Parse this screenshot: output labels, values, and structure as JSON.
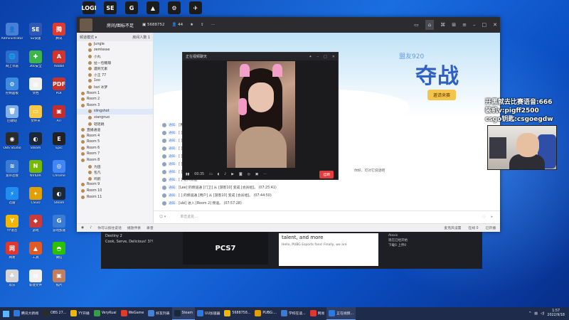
{
  "desktop_icons": [
    {
      "label": "Administrator",
      "color": "#4a7fd6",
      "glyph": "👤",
      "col": 0,
      "row": 0
    },
    {
      "label": "网上邻居",
      "color": "#2f6bc9",
      "glyph": "🌐",
      "col": 0,
      "row": 1
    },
    {
      "label": "控制面板",
      "color": "#3d8be0",
      "glyph": "⚙",
      "col": 0,
      "row": 2
    },
    {
      "label": "回收站",
      "color": "#7fb0e8",
      "glyph": "🗑",
      "col": 0,
      "row": 3
    },
    {
      "label": "OBS Studio",
      "color": "#2b2b2b",
      "glyph": "◉",
      "col": 0,
      "row": 4
    },
    {
      "label": "宽带连接",
      "color": "#3a7bd5",
      "glyph": "≋",
      "col": 0,
      "row": 5
    },
    {
      "label": "迅雷",
      "color": "#1f8df0",
      "glyph": "⚡",
      "col": 0,
      "row": 6
    },
    {
      "label": "YY语音",
      "color": "#f2b705",
      "glyph": "Y",
      "col": 0,
      "row": 7
    },
    {
      "label": "网易",
      "color": "#e0372e",
      "glyph": "网",
      "col": 0,
      "row": 8
    },
    {
      "label": "欢乐",
      "color": "#d6d6d6",
      "glyph": "♣",
      "col": 0,
      "row": 9
    },
    {
      "label": "SE快速",
      "color": "#2d58b8",
      "glyph": "SE",
      "col": 1,
      "row": 0
    },
    {
      "label": "360安全",
      "color": "#3eb549",
      "glyph": "✚",
      "col": 1,
      "row": 1
    },
    {
      "label": "文档",
      "color": "#f0f0f0",
      "glyph": "▤",
      "col": 1,
      "row": 2
    },
    {
      "label": "文件夹",
      "color": "#f5c945",
      "glyph": "▭",
      "col": 1,
      "row": 3
    },
    {
      "label": "Steam",
      "color": "#1b2838",
      "glyph": "◐",
      "col": 1,
      "row": 4
    },
    {
      "label": "NVIDIA",
      "color": "#76b900",
      "glyph": "N",
      "col": 1,
      "row": 5
    },
    {
      "label": "CSGO",
      "color": "#e0a000",
      "glyph": "✦",
      "col": 1,
      "row": 6
    },
    {
      "label": "游戏",
      "color": "#c93a3a",
      "glyph": "◆",
      "col": 1,
      "row": 7
    },
    {
      "label": "工具",
      "color": "#e05a23",
      "glyph": "▲",
      "col": 1,
      "row": 8
    },
    {
      "label": "新建文件",
      "color": "#f0f0f0",
      "glyph": "▤",
      "col": 1,
      "row": 9
    },
    {
      "label": "腾讯",
      "color": "#e03b2f",
      "glyph": "腾",
      "col": 2,
      "row": 0
    },
    {
      "label": "Adobe",
      "color": "#d4342c",
      "glyph": "A",
      "col": 2,
      "row": 1
    },
    {
      "label": "PDF",
      "color": "#c8322a",
      "glyph": "PDF",
      "col": 2,
      "row": 2
    },
    {
      "label": "ATI",
      "color": "#c32d2d",
      "glyph": "▣",
      "col": 2,
      "row": 3
    },
    {
      "label": "Epic",
      "color": "#222222",
      "glyph": "E",
      "col": 2,
      "row": 4
    },
    {
      "label": "Chrome",
      "color": "#4285f4",
      "glyph": "◎",
      "col": 2,
      "row": 5
    },
    {
      "label": "Steam",
      "color": "#1b2838",
      "glyph": "◐",
      "col": 2,
      "row": 6
    },
    {
      "label": "游戏加速",
      "color": "#3a7bd5",
      "glyph": "G",
      "col": 2,
      "row": 7
    },
    {
      "label": "微信",
      "color": "#2dc100",
      "glyph": "◓",
      "col": 2,
      "row": 8
    },
    {
      "label": "照片",
      "color": "#c08060",
      "glyph": "▣",
      "col": 2,
      "row": 9
    }
  ],
  "top_icons": [
    "LOGI",
    "SE",
    "G",
    "▲",
    "⚙",
    "✈"
  ],
  "app": {
    "title": "房间/图标不足",
    "viewers": "5688752",
    "fans": "44",
    "left_header_left": "频道模式 ▾",
    "left_header_right": "房间人数 1",
    "channel_items": [
      {
        "label": "Jungle",
        "cls": "sub"
      },
      {
        "label": "zemlesse",
        "cls": "sub"
      },
      {
        "label": "小丸",
        "cls": "sub"
      },
      {
        "label": "扯一包糖葫",
        "cls": "sub"
      },
      {
        "label": "遇到元素",
        "cls": "sub"
      },
      {
        "label": "小王 77",
        "cls": "sub"
      },
      {
        "label": "1oo",
        "cls": "sub"
      },
      {
        "label": "lozi 冰梦",
        "cls": "sub"
      },
      {
        "label": "Room 1",
        "cls": ""
      },
      {
        "label": "Room 2",
        "cls": ""
      },
      {
        "label": "Room 3",
        "cls": ""
      },
      {
        "label": "slingshot",
        "cls": "sub hl"
      },
      {
        "label": "xiangnuo",
        "cls": "sub"
      },
      {
        "label": "轻轻跳",
        "cls": "sub"
      },
      {
        "label": "直播通道",
        "cls": ""
      },
      {
        "label": "Room 4",
        "cls": ""
      },
      {
        "label": "Room 5",
        "cls": ""
      },
      {
        "label": "Room 6",
        "cls": ""
      },
      {
        "label": "Room 7",
        "cls": ""
      },
      {
        "label": "Room 8",
        "cls": ""
      },
      {
        "label": "为田",
        "cls": "sub"
      },
      {
        "label": "包凡",
        "cls": "sub"
      },
      {
        "label": "鸣鹤",
        "cls": "sub"
      },
      {
        "label": "Room 9",
        "cls": ""
      },
      {
        "label": "Room 10",
        "cls": ""
      },
      {
        "label": "Room 11",
        "cls": ""
      }
    ],
    "banner_tag": "盟友920",
    "banner_title": "夺战",
    "banner_button": "邀请来赛",
    "chat": [
      {
        "who": "通知:",
        "text": "[用户] 进入频道"
      },
      {
        "who": "通知:",
        "text": "[ ] 欢迎来到频道"
      },
      {
        "who": "通知:",
        "text": "[ ] 用户"
      },
      {
        "who": "通知:",
        "text": "[ ] 进入频道"
      },
      {
        "who": "通知:",
        "text": "[ ] 进入"
      },
      {
        "who": "通知:",
        "text": "[ ] 加入频道"
      },
      {
        "who": "通知:",
        "text": "[ ] 你好，欢迎进入"
      },
      {
        "who": "通知:",
        "text": "[ ] 进入频道"
      },
      {
        "who": "通知:",
        "text": "[Lee] 的频道通 [门卫] 从 [游客10] 变成 [会员组]。 (07:25:41)"
      },
      {
        "who": "通知:",
        "text": "[ ] 的频道通 [用户] 从 [游客10] 变成 [会员组]。 (07:44:50)"
      },
      {
        "who": "通知:",
        "text": "[ubi] 进入 [Room 2] 频道。 (07:57:28)"
      }
    ],
    "chat_right_note": "你好，可对它说话吧",
    "input_placeholder": "单击此处...",
    "bottom_left": [
      "你可以按住说话",
      "播放伴奏",
      "录音"
    ],
    "bottom_right": [
      "麦克风设置",
      "在线 0",
      "已开播"
    ]
  },
  "video_popup": {
    "title": "正在视频聊天",
    "time": "00:35",
    "hangup": "挂断"
  },
  "overlay_text": [
    "开黑就去比赛语音:666",
    "装机v:pigff2500",
    "csgo钥匙:csgoegdw"
  ],
  "stream": {
    "left_lines": [
      "Destiny 2",
      "Cook, Serve, Delicious! 3?!"
    ],
    "center_title": "PCS7",
    "right_card_title": "talent, and more",
    "right_card_sub": "Hello, PUBG Esports fans! Finally, we are",
    "side_lines": [
      "Alexis",
      "现在已经开始",
      "下载0 上传0"
    ]
  },
  "taskbar": {
    "items": [
      {
        "label": "腾讯大新闻",
        "color": "#2a7ae0",
        "active": false
      },
      {
        "label": "OBS 27...",
        "color": "#2b2b2b",
        "active": false
      },
      {
        "label": "YY开播",
        "color": "#f2b705",
        "active": false
      },
      {
        "label": "VeryKuai",
        "color": "#3a9b4a",
        "active": false
      },
      {
        "label": "WeGame",
        "color": "#e03b2f",
        "active": false
      },
      {
        "label": "好友列表",
        "color": "#4a7fd6",
        "active": false
      },
      {
        "label": "Steam",
        "color": "#1b2838",
        "active": true
      },
      {
        "label": "UU加速器",
        "color": "#2a7ae0",
        "active": false
      },
      {
        "label": "5688758...",
        "color": "#f2b705",
        "active": false
      },
      {
        "label": "PUBG:...",
        "color": "#e0a000",
        "active": false
      },
      {
        "label": "学校在读...",
        "color": "#3a7bd5",
        "active": false
      },
      {
        "label": "网易",
        "color": "#e0372e",
        "active": false
      },
      {
        "label": "正在视频...",
        "color": "#2a7ae0",
        "active": true
      }
    ],
    "time": "1:57",
    "date": "2022/9/18"
  }
}
